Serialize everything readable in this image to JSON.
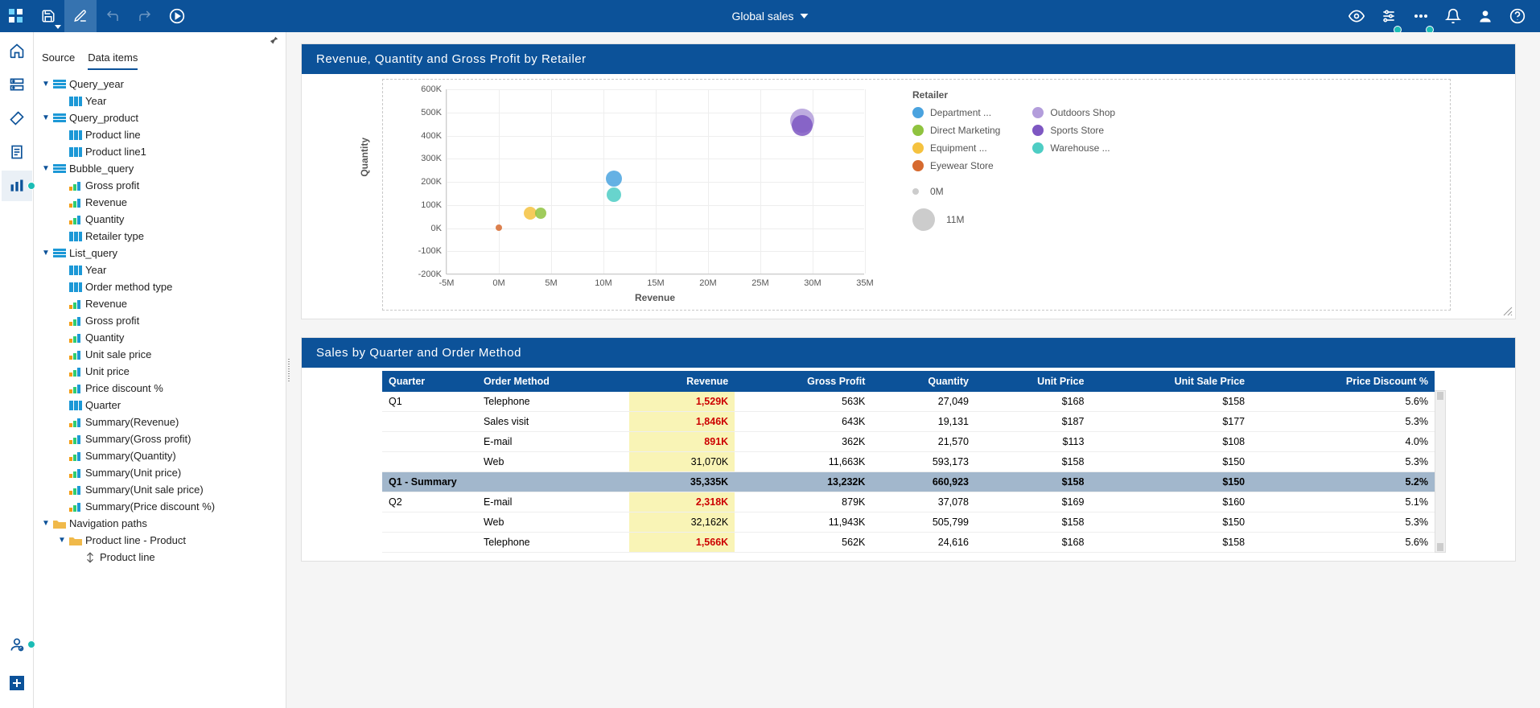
{
  "appbar": {
    "title": "Global sales"
  },
  "dataPanel": {
    "tabs": {
      "source": "Source",
      "dataItems": "Data items"
    },
    "tree": [
      {
        "lvl": 0,
        "tw": "▼",
        "ico": "query",
        "label": "Query_year"
      },
      {
        "lvl": 1,
        "tw": "",
        "ico": "mbar",
        "label": "Year"
      },
      {
        "lvl": 0,
        "tw": "▼",
        "ico": "query",
        "label": "Query_product"
      },
      {
        "lvl": 1,
        "tw": "",
        "ico": "mbar",
        "label": "Product line"
      },
      {
        "lvl": 1,
        "tw": "",
        "ico": "mbar",
        "label": "Product line1"
      },
      {
        "lvl": 0,
        "tw": "▼",
        "ico": "query",
        "label": "Bubble_query"
      },
      {
        "lvl": 1,
        "tw": "",
        "ico": "meas",
        "label": "Gross profit"
      },
      {
        "lvl": 1,
        "tw": "",
        "ico": "meas",
        "label": "Revenue"
      },
      {
        "lvl": 1,
        "tw": "",
        "ico": "meas",
        "label": "Quantity"
      },
      {
        "lvl": 1,
        "tw": "",
        "ico": "mbar",
        "label": "Retailer type"
      },
      {
        "lvl": 0,
        "tw": "▼",
        "ico": "query",
        "label": "List_query"
      },
      {
        "lvl": 1,
        "tw": "",
        "ico": "mbar",
        "label": "Year"
      },
      {
        "lvl": 1,
        "tw": "",
        "ico": "mbar",
        "label": "Order method type"
      },
      {
        "lvl": 1,
        "tw": "",
        "ico": "meas",
        "label": "Revenue"
      },
      {
        "lvl": 1,
        "tw": "",
        "ico": "meas",
        "label": "Gross profit"
      },
      {
        "lvl": 1,
        "tw": "",
        "ico": "meas",
        "label": "Quantity"
      },
      {
        "lvl": 1,
        "tw": "",
        "ico": "meas",
        "label": "Unit sale price"
      },
      {
        "lvl": 1,
        "tw": "",
        "ico": "meas",
        "label": "Unit price"
      },
      {
        "lvl": 1,
        "tw": "",
        "ico": "meas",
        "label": "Price discount %"
      },
      {
        "lvl": 1,
        "tw": "",
        "ico": "mbar",
        "label": "Quarter"
      },
      {
        "lvl": 1,
        "tw": "",
        "ico": "meas",
        "label": "Summary(Revenue)"
      },
      {
        "lvl": 1,
        "tw": "",
        "ico": "meas",
        "label": "Summary(Gross profit)"
      },
      {
        "lvl": 1,
        "tw": "",
        "ico": "meas",
        "label": "Summary(Quantity)"
      },
      {
        "lvl": 1,
        "tw": "",
        "ico": "meas",
        "label": "Summary(Unit price)"
      },
      {
        "lvl": 1,
        "tw": "",
        "ico": "meas",
        "label": "Summary(Unit sale price)"
      },
      {
        "lvl": 1,
        "tw": "",
        "ico": "meas",
        "label": "Summary(Price discount %)"
      },
      {
        "lvl": 0,
        "tw": "▼",
        "ico": "folder",
        "label": "Navigation paths"
      },
      {
        "lvl": 1,
        "tw": "▼",
        "ico": "folder",
        "label": "Product line - Product"
      },
      {
        "lvl": 2,
        "tw": "",
        "ico": "nav",
        "label": "Product line"
      }
    ]
  },
  "chart": {
    "title": "Revenue, Quantity and Gross Profit by Retailer",
    "xlabel": "Revenue",
    "ylabel": "Quantity",
    "yticks": [
      "600K",
      "500K",
      "400K",
      "300K",
      "200K",
      "100K",
      "0K",
      "-100K",
      "-200K"
    ],
    "xticks": [
      "-5M",
      "0M",
      "5M",
      "10M",
      "15M",
      "20M",
      "25M",
      "30M",
      "35M"
    ],
    "legendTitle": "Retailer",
    "legendLeft": [
      {
        "label": "Department ...",
        "color": "#4aa3df"
      },
      {
        "label": "Direct Marketing",
        "color": "#8fc33f"
      },
      {
        "label": "Equipment ...",
        "color": "#f5c23f"
      },
      {
        "label": "Eyewear Store",
        "color": "#d66a2f"
      }
    ],
    "legendRight": [
      {
        "label": "Outdoors Shop",
        "color": "#b39ddb"
      },
      {
        "label": "Sports Store",
        "color": "#7e57c2"
      },
      {
        "label": "Warehouse ...",
        "color": "#4ecdc4"
      }
    ],
    "sizeLegend": [
      {
        "label": "0M",
        "size": 8
      },
      {
        "label": "11M",
        "size": 28
      }
    ],
    "bubbles": [
      {
        "x": 0,
        "y": 0,
        "size": 8,
        "color": "#d66a2f"
      },
      {
        "x": 3,
        "y": 60,
        "size": 16,
        "color": "#f5c23f"
      },
      {
        "x": 4,
        "y": 60,
        "size": 14,
        "color": "#8fc33f"
      },
      {
        "x": 11,
        "y": 210,
        "size": 20,
        "color": "#4aa3df"
      },
      {
        "x": 11,
        "y": 140,
        "size": 18,
        "color": "#4ecdc4"
      },
      {
        "x": 29,
        "y": 460,
        "size": 30,
        "color": "#b39ddb"
      },
      {
        "x": 29,
        "y": 440,
        "size": 26,
        "color": "#7e57c2"
      }
    ]
  },
  "chart_data": {
    "type": "scatter",
    "title": "Revenue, Quantity and Gross Profit by Retailer",
    "xlabel": "Revenue",
    "ylabel": "Quantity",
    "xlim": [
      -5,
      35
    ],
    "ylim": [
      -200,
      600
    ],
    "x_unit": "M",
    "y_unit": "K",
    "size_encodes": "Gross Profit (M)",
    "series": [
      {
        "name": "Eyewear Store",
        "x": 0,
        "y": 0,
        "size": 0,
        "color": "#d66a2f"
      },
      {
        "name": "Equipment Rental Store",
        "x": 3,
        "y": 60,
        "size": 1,
        "color": "#f5c23f"
      },
      {
        "name": "Direct Marketing",
        "x": 4,
        "y": 60,
        "size": 1,
        "color": "#8fc33f"
      },
      {
        "name": "Department Store",
        "x": 11,
        "y": 210,
        "size": 4,
        "color": "#4aa3df"
      },
      {
        "name": "Warehouse Store",
        "x": 11,
        "y": 140,
        "size": 3,
        "color": "#4ecdc4"
      },
      {
        "name": "Outdoors Shop",
        "x": 29,
        "y": 460,
        "size": 11,
        "color": "#b39ddb"
      },
      {
        "name": "Sports Store",
        "x": 29,
        "y": 440,
        "size": 10,
        "color": "#7e57c2"
      }
    ]
  },
  "table": {
    "title": "Sales by Quarter and Order Method",
    "headers": [
      "Quarter",
      "Order Method",
      "Revenue",
      "Gross Profit",
      "Quantity",
      "Unit Price",
      "Unit Sale Price",
      "Price Discount %"
    ],
    "rows": [
      {
        "q": "Q1",
        "om": "Telephone",
        "rev": "1,529K",
        "revHi": true,
        "gp": "563K",
        "qty": "27,049",
        "up": "$168",
        "usp": "$158",
        "pd": "5.6%"
      },
      {
        "q": "",
        "om": "Sales visit",
        "rev": "1,846K",
        "revHi": true,
        "gp": "643K",
        "qty": "19,131",
        "up": "$187",
        "usp": "$177",
        "pd": "5.3%"
      },
      {
        "q": "",
        "om": "E-mail",
        "rev": "891K",
        "revHi": true,
        "gp": "362K",
        "qty": "21,570",
        "up": "$113",
        "usp": "$108",
        "pd": "4.0%"
      },
      {
        "q": "",
        "om": "Web",
        "rev": "31,070K",
        "revHi": false,
        "gp": "11,663K",
        "qty": "593,173",
        "up": "$158",
        "usp": "$150",
        "pd": "5.3%"
      },
      {
        "summary": true,
        "q": "Q1 - Summary",
        "om": "",
        "rev": "35,335K",
        "gp": "13,232K",
        "qty": "660,923",
        "up": "$158",
        "usp": "$150",
        "pd": "5.2%"
      },
      {
        "q": "Q2",
        "om": "E-mail",
        "rev": "2,318K",
        "revHi": true,
        "gp": "879K",
        "qty": "37,078",
        "up": "$169",
        "usp": "$160",
        "pd": "5.1%"
      },
      {
        "q": "",
        "om": "Web",
        "rev": "32,162K",
        "revHi": false,
        "gp": "11,943K",
        "qty": "505,799",
        "up": "$158",
        "usp": "$150",
        "pd": "5.3%"
      },
      {
        "q": "",
        "om": "Telephone",
        "rev": "1,566K",
        "revHi": true,
        "gp": "562K",
        "qty": "24,616",
        "up": "$168",
        "usp": "$158",
        "pd": "5.6%"
      }
    ]
  }
}
